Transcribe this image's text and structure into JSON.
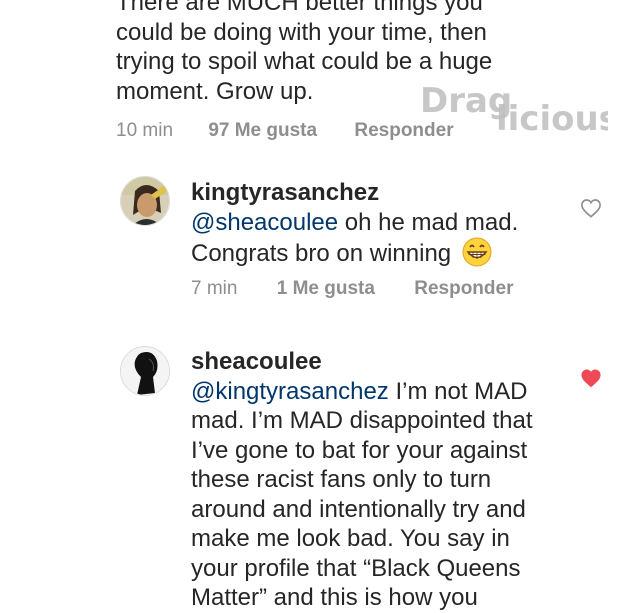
{
  "first_comment": {
    "lines": [
      "There are MUCH better things you",
      "could be doing with your time, then",
      "trying to spoil what could be a huge",
      "moment. Grow up."
    ],
    "time": "10 min",
    "likes": "97 Me gusta",
    "reply": "Responder"
  },
  "watermark": {
    "text_a": "Drag",
    "text_b": "licious"
  },
  "comment_2": {
    "username": "kingtyrasanchez",
    "mention": "@sheacoulee",
    "line1_rest": " oh he mad mad.",
    "line2": "Congrats bro on winning",
    "emoji": "grinning-face-emoji",
    "time": "7 min",
    "likes": "1 Me gusta",
    "reply": "Responder",
    "liked": false
  },
  "comment_3": {
    "username": "sheacoulee",
    "mention": "@kingtyrasanchez",
    "line1_rest": " I’m not MAD",
    "lines": [
      "mad. I’m MAD disappointed that",
      "I’ve gone to bat for your against",
      "these racist fans only to turn",
      "around and intentionally try and",
      "make me look bad. You say in",
      "your profile that “Black Queens",
      "Matter” and this is how you"
    ],
    "liked": true
  },
  "colors": {
    "text": "#262626",
    "muted": "#8e8e8e",
    "mention": "#00376b",
    "heart_liked": "#ed4956",
    "heart_outline": "#8e8e8e"
  }
}
